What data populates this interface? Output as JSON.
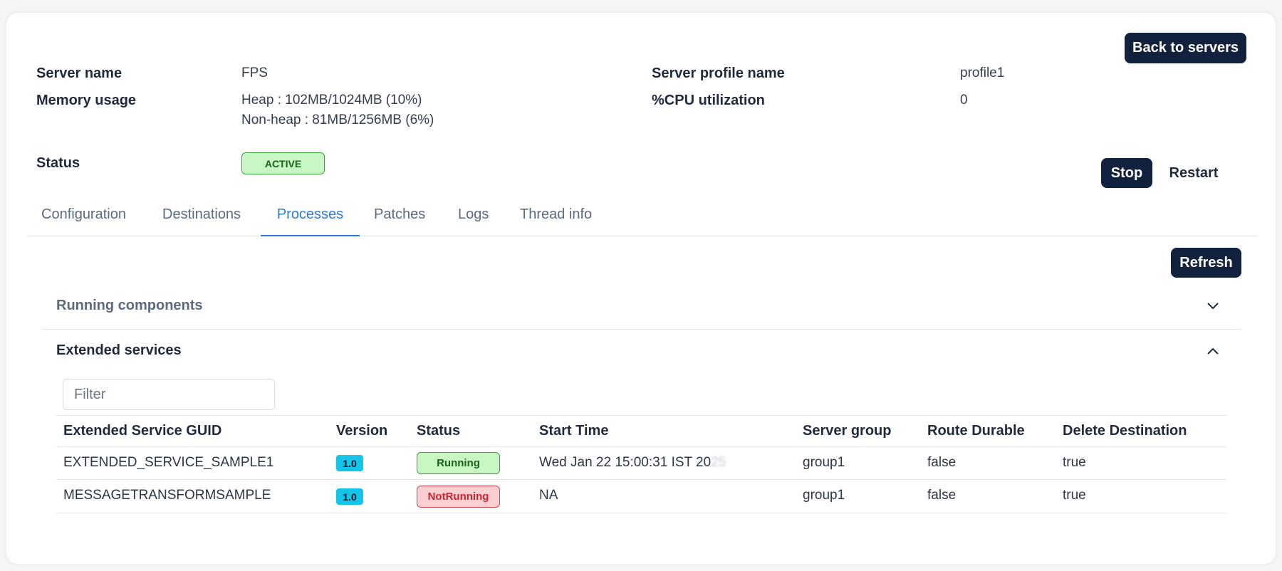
{
  "header": {
    "back_label": "Back to servers",
    "server_name_label": "Server name",
    "server_name_value": "FPS",
    "memory_label": "Memory usage",
    "memory_heap": "Heap : 102MB/1024MB (10%)",
    "memory_nonheap": "Non-heap : 81MB/1256MB (6%)",
    "status_label": "Status",
    "status_value": "ACTIVE",
    "profile_label": "Server profile name",
    "profile_value": "profile1",
    "cpu_label": "%CPU utilization",
    "cpu_value": "0",
    "stop_label": "Stop",
    "restart_label": "Restart"
  },
  "tabs": [
    {
      "label": "Configuration"
    },
    {
      "label": "Destinations"
    },
    {
      "label": "Processes"
    },
    {
      "label": "Patches"
    },
    {
      "label": "Logs"
    },
    {
      "label": "Thread info"
    }
  ],
  "processes": {
    "refresh_label": "Refresh",
    "running_components_title": "Running components",
    "extended_services_title": "Extended services",
    "filter_placeholder": "Filter",
    "columns": [
      "Extended Service GUID",
      "Version",
      "Status",
      "Start Time",
      "Server group",
      "Route Durable",
      "Delete Destination"
    ],
    "rows": [
      {
        "guid": "EXTENDED_SERVICE_SAMPLE1",
        "version": "1.0",
        "status": "Running",
        "start_time": "Wed Jan 22 15:00:31 IST 20",
        "start_time_obscured": "25",
        "server_group": "group1",
        "route_durable": "false",
        "delete_destination": "true"
      },
      {
        "guid": "MESSAGETRANSFORMSAMPLE",
        "version": "1.0",
        "status": "NotRunning",
        "start_time": "NA",
        "start_time_obscured": "",
        "server_group": "group1",
        "route_durable": "false",
        "delete_destination": "true"
      }
    ]
  },
  "colors": {
    "primary_button": "#12213d",
    "active_tab": "#2f7bd8",
    "running": "#c9f7c3",
    "not_running": "#fbcfd2",
    "version_badge": "#16c4ea"
  }
}
